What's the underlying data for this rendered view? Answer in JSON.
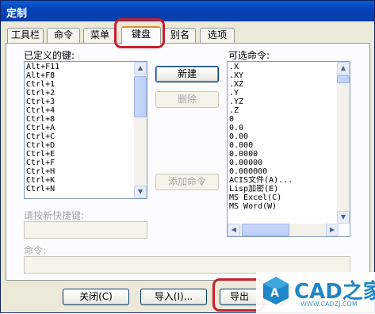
{
  "window": {
    "title": "定制"
  },
  "tabs": [
    "工具栏",
    "命令",
    "菜单",
    "键盘",
    "别名",
    "选项"
  ],
  "active_tab": "键盘",
  "defined_keys": {
    "label": "已定义的键:",
    "items": [
      "Alt+F11",
      "Alt+F8",
      "Ctrl+1",
      "Ctrl+2",
      "Ctrl+3",
      "Ctrl+4",
      "Ctrl+8",
      "Ctrl+A",
      "Ctrl+C",
      "Ctrl+D",
      "Ctrl+E",
      "Ctrl+F",
      "Ctrl+H",
      "Ctrl+K",
      "Ctrl+N"
    ]
  },
  "buttons": {
    "new": "新建",
    "delete": "删除",
    "add_command": "添加命令",
    "close": "关闭(C)",
    "import": "导入(I)...",
    "export": "导出"
  },
  "available_commands": {
    "label": "可选命令:",
    "items": [
      ".X",
      ".XY",
      ".XZ",
      ".Y",
      ".YZ",
      ".Z",
      "0",
      "0.0",
      "0.00",
      "0.000",
      "0.0000",
      "0.00000",
      "0.000000",
      "ACIS文件(A)...",
      "Lisp加密(E)",
      "MS Excel(C)",
      "MS Word(W)"
    ]
  },
  "new_shortcut": {
    "label": "请按新快捷键:",
    "value": ""
  },
  "command": {
    "label": "命令:",
    "value": ""
  },
  "watermark": {
    "title": "CAD之家",
    "url": "WWW.CADZJ.COM"
  },
  "colors": {
    "highlight": "#c81e2e",
    "title_bar": "#0a4fc8",
    "brand": "#1f86c8"
  }
}
